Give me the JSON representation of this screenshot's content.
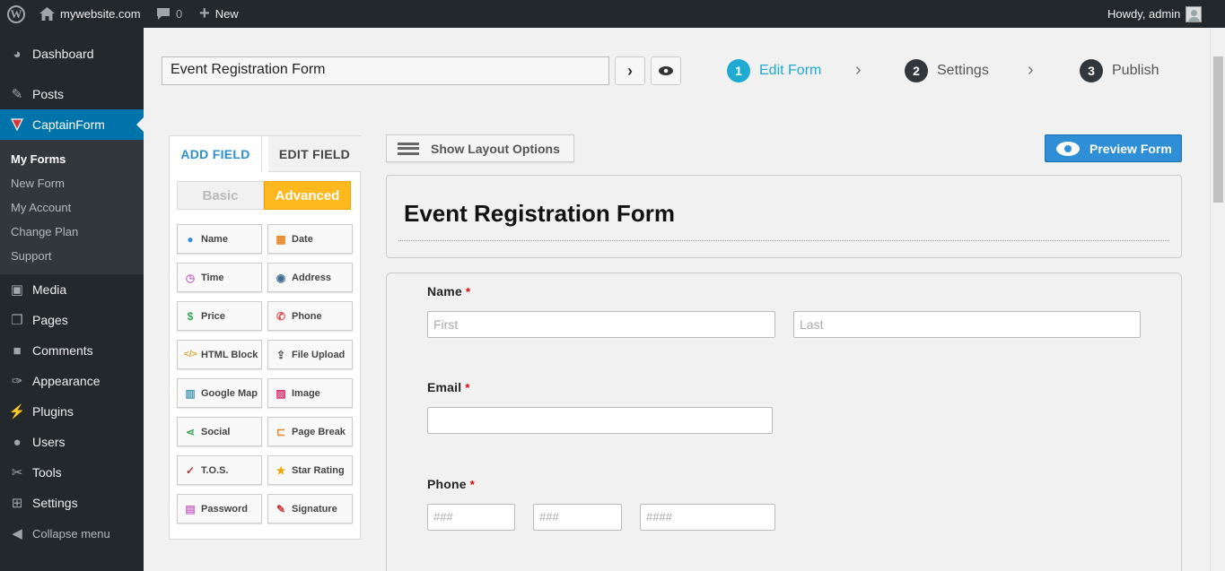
{
  "adminbar": {
    "site_name": "mywebsite.com",
    "comments_count": "0",
    "new_label": "New",
    "greeting": "Howdy, admin"
  },
  "sidebar": {
    "items": [
      {
        "label": "Dashboard",
        "icon": "dashboard-icon"
      },
      {
        "label": "Posts",
        "icon": "pin-icon"
      },
      {
        "label": "CaptainForm",
        "icon": "captainform-icon"
      },
      {
        "label": "Media",
        "icon": "media-icon"
      },
      {
        "label": "Pages",
        "icon": "pages-icon"
      },
      {
        "label": "Comments",
        "icon": "comments-icon"
      },
      {
        "label": "Appearance",
        "icon": "paintbrush-icon"
      },
      {
        "label": "Plugins",
        "icon": "plugin-icon"
      },
      {
        "label": "Users",
        "icon": "users-icon"
      },
      {
        "label": "Tools",
        "icon": "wrench-icon"
      },
      {
        "label": "Settings",
        "icon": "settings-icon"
      },
      {
        "label": "Collapse menu",
        "icon": "collapse-icon"
      }
    ],
    "submenu": [
      "My Forms",
      "New Form",
      "My Account",
      "Change Plan",
      "Support"
    ]
  },
  "editor": {
    "form_name_value": "Event Registration Form",
    "steps": [
      {
        "num": "1",
        "label": "Edit Form"
      },
      {
        "num": "2",
        "label": "Settings"
      },
      {
        "num": "3",
        "label": "Publish"
      }
    ]
  },
  "fields_panel": {
    "tabs": [
      "ADD FIELD",
      "EDIT FIELD"
    ],
    "segments": [
      "Basic",
      "Advanced"
    ],
    "buttons": [
      "Name",
      "Date",
      "Time",
      "Address",
      "Price",
      "Phone",
      "HTML Block",
      "File Upload",
      "Google Map",
      "Image",
      "Social",
      "Page Break",
      "T.O.S.",
      "Star Rating",
      "Password",
      "Signature"
    ]
  },
  "toolbar": {
    "layout_label": "Show Layout Options",
    "preview_label": "Preview Form"
  },
  "form": {
    "title": "Event Registration Form",
    "required_mark": "*",
    "name_label": "Name",
    "first_placeholder": "First",
    "last_placeholder": "Last",
    "email_label": "Email",
    "phone_label": "Phone",
    "phone_area_placeholder": "###",
    "phone_prefix_placeholder": "###",
    "phone_line_placeholder": "####"
  },
  "colors": {
    "accent": "#1eaad1",
    "sidebar_active": "#0073aa",
    "advanced_tab": "#ffb91f",
    "preview_button": "#2e8fd6"
  }
}
